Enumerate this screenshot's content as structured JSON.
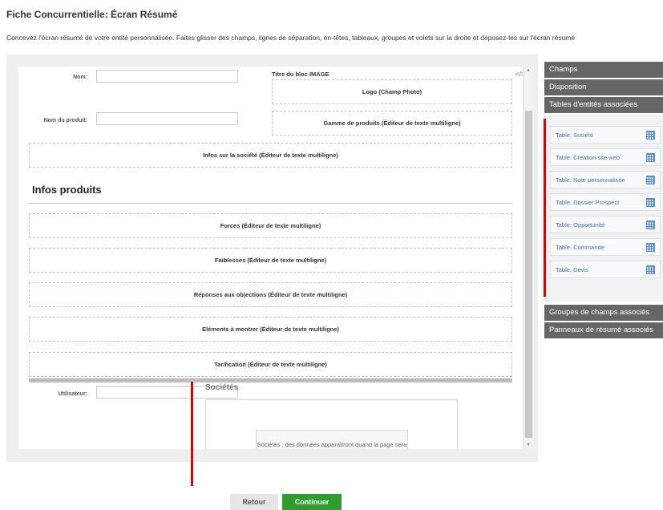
{
  "page": {
    "title": "Fiche Concurrentielle: Écran Résumé",
    "description": "Concevez l'écran résumé de votre entité personnalisée. Faites glisser des champs, lignes de séparation, en-têtes, tableaux, groupes et volets sur la droite et déposez-les sur l'écran résumé"
  },
  "canvas": {
    "nom_label": "Nom:",
    "produit_label": "Nom du produit:",
    "image_block_title": "Titre du bloc IMAGE",
    "code_icon": "</>",
    "logo_field": "Logo (Champ Photo)",
    "gamme_field": "Gamme de produits (Éditeur de texte multiligne)",
    "infos_societe_field": "Infos sur la société (Éditeur de texte multiligne)",
    "section_heading": "Infos produits",
    "forces_field": "Forces (Éditeur de texte multiligne)",
    "faiblesses_field": "Faiblesses (Éditeur de texte multiligne)",
    "reponses_field": "Réponses aux objections (Éditeur de texte multiligne)",
    "elements_field": "Eléments à montrer (Éditeur de texte multiligne)",
    "tarification_field": "Tarification (Éditeur de texte multiligne)",
    "utilisateur_label": "Utilisateur:"
  },
  "subpanel": {
    "title": "Sociétés",
    "message": "Sociétés : des données apparaîtront quand la page sera restituée"
  },
  "sidebar": {
    "champs": "Champs",
    "disposition": "Disposition",
    "tables_title": "Tables d'entités associées",
    "tables": [
      "Table: Société",
      "Table: Creation site web",
      "Table: Note personnalisée",
      "Table: Dossier Prospect",
      "Table: Opportunité",
      "Table: Commande",
      "Table: Devis"
    ],
    "groupes": "Groupes de champs associés",
    "panneaux": "Panneaux de résumé associés"
  },
  "buttons": {
    "back": "Retour",
    "next": "Continuer"
  },
  "colors": {
    "sidebar_bg": "#666666",
    "continue_green": "#2e9d2e",
    "link_blue": "#3a72b8",
    "annotation_red": "#e00000"
  }
}
